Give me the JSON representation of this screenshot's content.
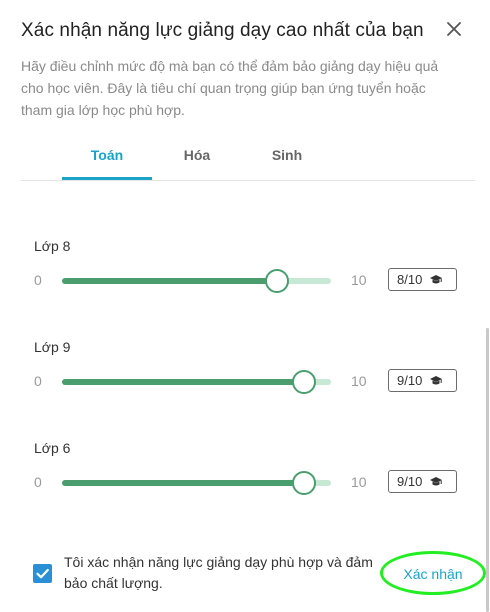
{
  "dialog": {
    "title": "Xác nhận năng lực giảng dạy cao nhất của bạn",
    "description": "Hãy điều chỉnh mức độ mà bạn có thể đảm bảo giảng dạy hiệu quả cho học viên. Đây là tiêu chí quan trọng giúp bạn ứng tuyển hoặc tham gia lớp học phù hợp."
  },
  "tabs": [
    {
      "label": "Toán",
      "active": true
    },
    {
      "label": "Hóa",
      "active": false
    },
    {
      "label": "Sinh",
      "active": false
    }
  ],
  "grades": [
    {
      "label": "Lớp 8",
      "min": "0",
      "max": "10",
      "value": 8,
      "badge": "8/10"
    },
    {
      "label": "Lớp 9",
      "min": "0",
      "max": "10",
      "value": 9,
      "badge": "9/10"
    },
    {
      "label": "Lớp 6",
      "min": "0",
      "max": "10",
      "value": 9,
      "badge": "9/10"
    }
  ],
  "confirm": {
    "checked": true,
    "text": "Tôi xác nhận năng lực giảng dạy phù hợp và đảm bảo chất lượng."
  },
  "footer": {
    "confirm_button": "Xác nhận"
  },
  "colors": {
    "accent": "#1aa3c9",
    "slider_fill": "#4a9e6e",
    "slider_track": "#c8e8d6",
    "checkbox": "#2b8fd6",
    "highlight": "#22ee22"
  },
  "icons": {
    "close": "close-icon",
    "badge": "graduation-cap-icon",
    "check": "checkmark-icon"
  }
}
